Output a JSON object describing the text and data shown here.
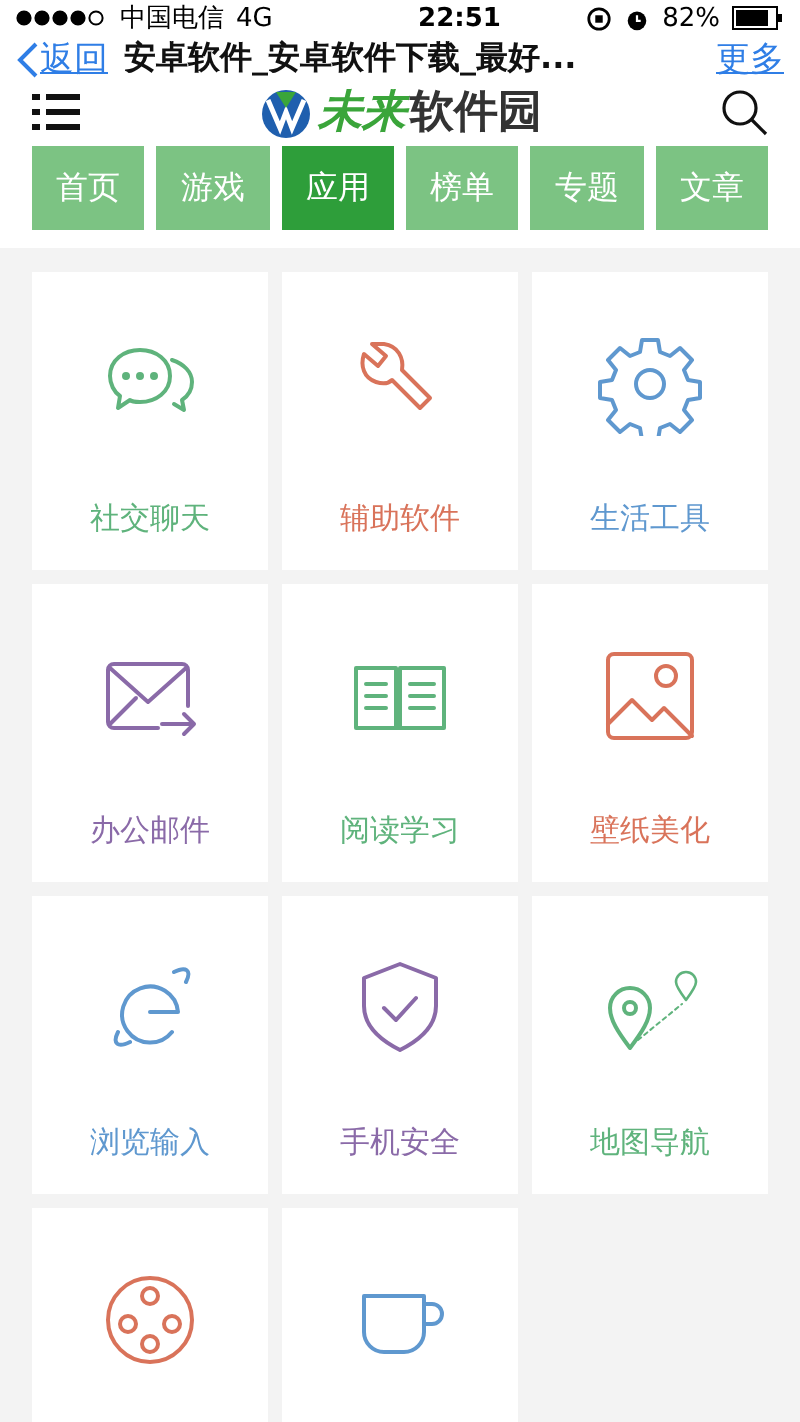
{
  "status_bar": {
    "carrier": "中国电信",
    "network": "4G",
    "time": "22:51",
    "battery": "82%"
  },
  "nav_bar": {
    "back": "返回",
    "title": "安卓软件_安卓软件下载_最好...",
    "more": "更多"
  },
  "header": {
    "logo": {
      "part_1": "未来",
      "part_2": "软件园"
    }
  },
  "tabs": [
    {
      "label": "首页",
      "selected": false
    },
    {
      "label": "游戏",
      "selected": false
    },
    {
      "label": "应用",
      "selected": true
    },
    {
      "label": "榜单",
      "selected": false
    },
    {
      "label": "专题",
      "selected": false
    },
    {
      "label": "文章",
      "selected": false
    }
  ],
  "categories": [
    {
      "label": "社交聊天",
      "color": "#5fb37c"
    },
    {
      "label": "辅助软件",
      "color": "#d9735a"
    },
    {
      "label": "生活工具",
      "color": "#5f98cf"
    },
    {
      "label": "办公邮件",
      "color": "#8a6aa8"
    },
    {
      "label": "阅读学习",
      "color": "#5fb37c"
    },
    {
      "label": "壁纸美化",
      "color": "#d9735a"
    },
    {
      "label": "浏览输入",
      "color": "#5f98cf"
    },
    {
      "label": "手机安全",
      "color": "#8a6aa8"
    },
    {
      "label": "地图导航",
      "color": "#5fb37c"
    },
    {
      "color": "#d9735a"
    },
    {
      "color": "#5f98cf"
    }
  ]
}
